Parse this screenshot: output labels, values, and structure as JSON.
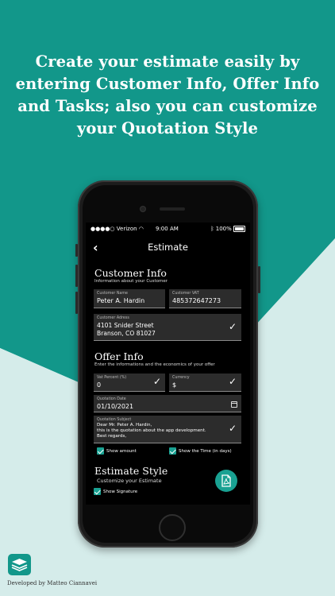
{
  "headline": "Create your estimate easily by entering Customer Info, Offer Info and Tasks; also you can customize your Quotation Style",
  "status_bar": {
    "carrier": "Verizon",
    "time": "9:00 AM",
    "battery": "100%"
  },
  "nav": {
    "title": "Estimate"
  },
  "customer_info": {
    "title": "Customer Info",
    "subtitle": "Information about your Customer",
    "name": {
      "label": "Customer Name",
      "value": "Peter A. Hardin"
    },
    "vat": {
      "label": "Customer VAT",
      "value": "485372647273"
    },
    "address": {
      "label": "Customer Adress",
      "line1": "4101 Snider Street",
      "line2": "Branson, CO 81027"
    }
  },
  "offer_info": {
    "title": "Offer Info",
    "subtitle": "Enter the informations and the economics of your offer",
    "vat_percent": {
      "label": "Vat Percent (%)",
      "value": "0"
    },
    "currency": {
      "label": "Currency",
      "value": "$"
    },
    "date": {
      "label": "Quotation Date",
      "value": "01/10/2021"
    },
    "subject": {
      "label": "Quotation Subject",
      "line1": "Dear Mr. Peter A. Hardin,",
      "line2": "this is the quotation about the app development.",
      "line3": "Best regards,"
    },
    "show_amount": "Show amount",
    "show_time": "Show the Time (in days)"
  },
  "estimate_style": {
    "title": "Estimate Style",
    "subtitle": "Customize your Estimate",
    "show_signature": "Show Signature"
  },
  "footer": {
    "developer": "Developed by Matteo Ciannavei"
  },
  "colors": {
    "accent": "#12978a",
    "checkbox": "#19a192",
    "field_bg": "#2c2c2c",
    "light_bg": "#d5ecea"
  }
}
